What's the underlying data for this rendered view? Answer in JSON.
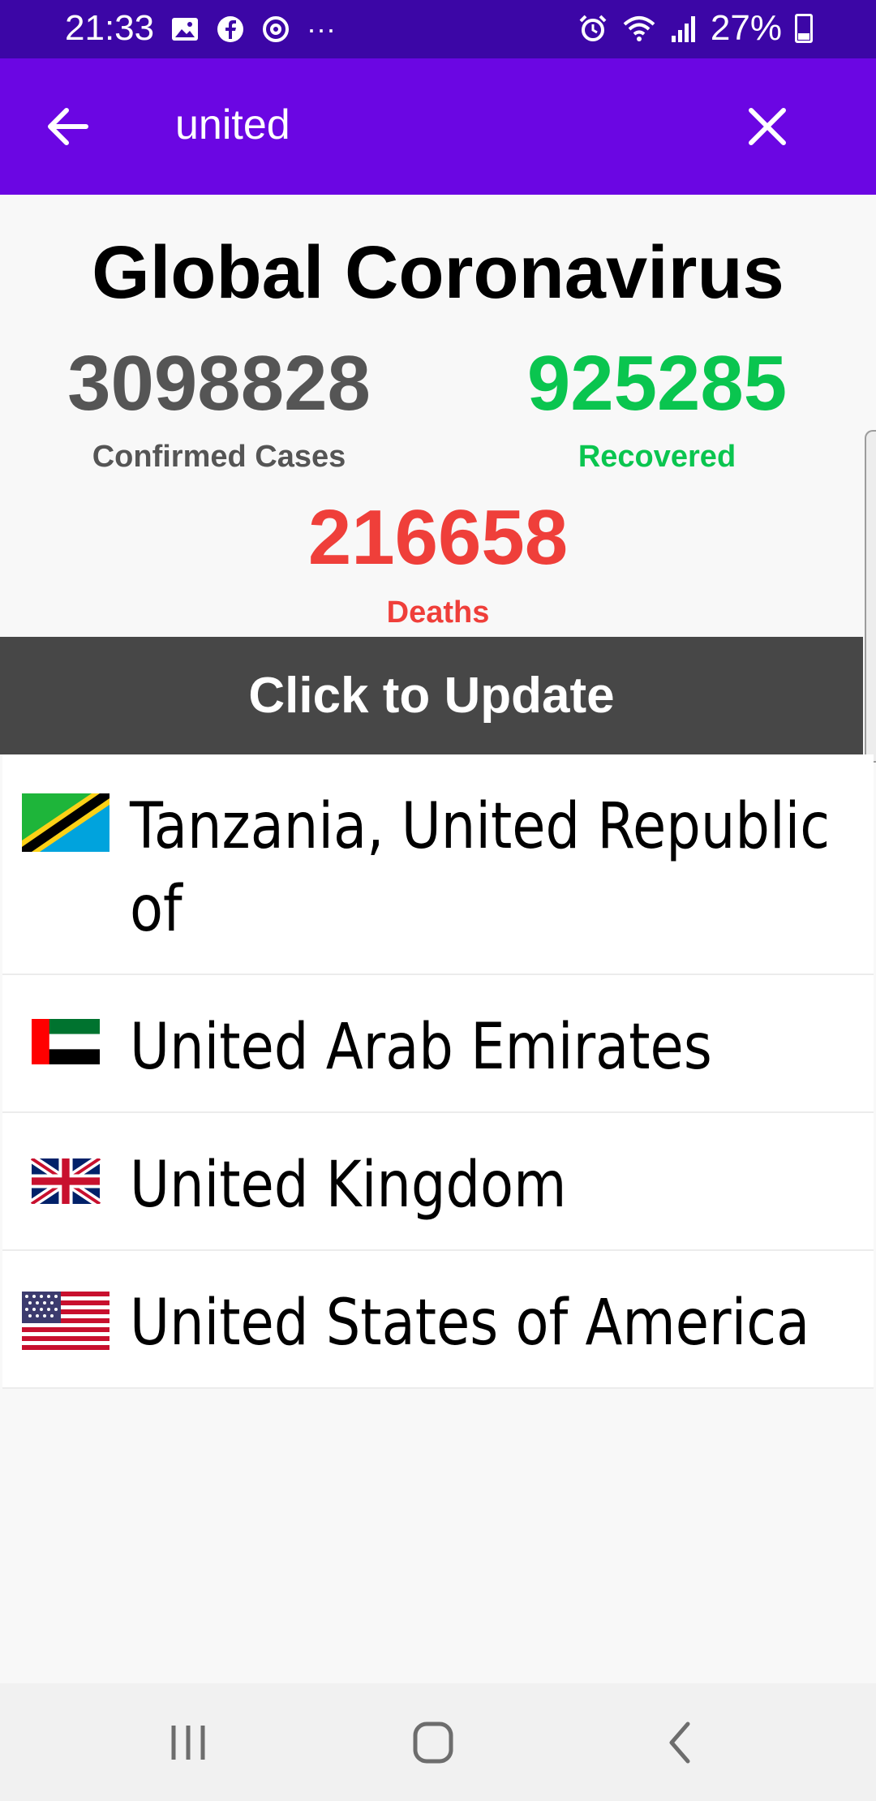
{
  "status_bar": {
    "time": "21:33",
    "battery": "27%",
    "left_icons": [
      "gallery-icon",
      "facebook-icon",
      "sync-icon",
      "more-icon"
    ],
    "right_icons": [
      "alarm-icon",
      "wifi-icon",
      "signal-icon",
      "battery-icon"
    ]
  },
  "app_bar": {
    "search_value": "united",
    "background": "#6b06e3"
  },
  "stats": {
    "title": "Global Coronavirus",
    "confirmed": {
      "value": "3098828",
      "label": "Confirmed Cases",
      "color": "#555555"
    },
    "recovered": {
      "value": "925285",
      "label": "Recovered",
      "color": "#0ac54f"
    },
    "deaths": {
      "value": "216658",
      "label": "Deaths",
      "color": "#ef3f3a"
    }
  },
  "update_button": {
    "label": "Click to Update"
  },
  "countries": [
    {
      "name": "Tanzania, United Republic of",
      "flag": "tanzania-flag-icon"
    },
    {
      "name": "United Arab Emirates",
      "flag": "uae-flag-icon"
    },
    {
      "name": "United Kingdom",
      "flag": "uk-flag-icon"
    },
    {
      "name": "United States of America",
      "flag": "usa-flag-icon"
    }
  ],
  "nav_bar": {
    "buttons": [
      "recent-apps-icon",
      "home-icon",
      "back-icon"
    ]
  }
}
